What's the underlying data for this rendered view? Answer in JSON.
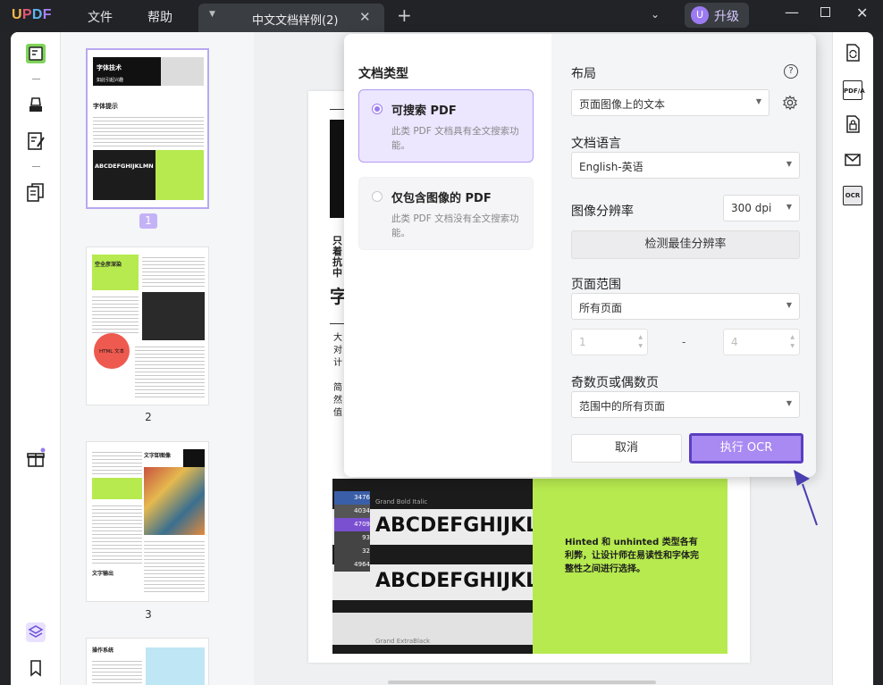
{
  "titlebar": {
    "logo": "UPDF",
    "menu": [
      "文件",
      "帮助"
    ],
    "tab_title": "中文文档样例(2)",
    "avatar_letter": "U",
    "upgrade_label": "升级"
  },
  "thumbnails": {
    "pages": [
      "1",
      "2",
      "3"
    ],
    "selected": "1",
    "p1": {
      "title": "字体技术",
      "sub": "如此引起兴趣",
      "hint": "字体提示",
      "sample": "ABCDEFGHIJKLMN"
    },
    "p2": {
      "title": "空全彦深染",
      "badge": "HTML 文本"
    },
    "p3": {
      "title": "文字卸图像",
      "sub": "文字输出"
    },
    "p4": {
      "title": "操作系统"
    }
  },
  "document": {
    "frag_lines": [
      "只",
      "着",
      "抗",
      "中"
    ],
    "frag_big": "字",
    "frag_para1": [
      "大",
      "对",
      "计"
    ],
    "frag_para2": [
      "简",
      "然",
      "值"
    ],
    "sample_text": "ABCDEFGHIJKLMNO",
    "weight_tags": [
      "3476",
      "4034",
      "4709",
      "93",
      "32",
      "4964"
    ],
    "font_label_1": "Grand Bold Italic",
    "font_label_2": "Grand ExtraBlack",
    "side_text": "Hinted 和 unhinted 类型各有利弊，让设计师在易读性和字体完整性之间进行选择。"
  },
  "ocr_dialog": {
    "doc_type_label": "文档类型",
    "options": [
      {
        "title": "可搜索 PDF",
        "desc": "此类 PDF 文档具有全文搜索功能。",
        "selected": true
      },
      {
        "title": "仅包含图像的 PDF",
        "desc": "此类 PDF 文档没有全文搜索功能。",
        "selected": false
      }
    ],
    "layout_label": "布局",
    "layout_value": "页面图像上的文本",
    "language_label": "文档语言",
    "language_value": "English-英语",
    "resolution_label": "图像分辨率",
    "resolution_value": "300 dpi",
    "detect_button": "检测最佳分辨率",
    "page_range_label": "页面范围",
    "page_range_value": "所有页面",
    "range_from": "1",
    "range_to": "4",
    "range_sep": "-",
    "odd_even_label": "奇数页或偶数页",
    "odd_even_value": "范围中的所有页面",
    "cancel_button": "取消",
    "run_button": "执行 OCR",
    "help_icon": "?"
  },
  "right_toolbar": {
    "items": [
      "convert-icon",
      "pdfa-icon",
      "protect-icon",
      "mail-icon",
      "ocr-icon"
    ],
    "pdfa_label": "PDF/A",
    "ocr_label": "OCR"
  },
  "colors": {
    "accent": "#9a7af0",
    "accent_light": "#ede6ff",
    "lime": "#b6ea4f",
    "titlebar": "#212327"
  }
}
